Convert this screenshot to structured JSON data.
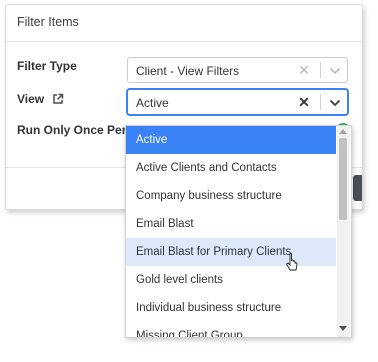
{
  "modal": {
    "title": "Filter Items"
  },
  "fields": {
    "filter_type_label": "Filter Type",
    "view_label": "View",
    "run_once_label": "Run Only Once Per Client"
  },
  "filter_type_select": {
    "value": "Client - View Filters"
  },
  "view_select": {
    "value": "Active"
  },
  "dropdown": {
    "options": [
      "Active",
      "Active Clients and Contacts",
      "Company business structure",
      "Email Blast",
      "Email Blast for Primary Clients",
      "Gold level clients",
      "Individual business structure",
      "Missing Client Group"
    ],
    "selected_index": 0,
    "hovered_index": 4
  },
  "colors": {
    "accent": "#3b82f6",
    "hover": "#dde8f8",
    "toggle_on": "#3bb36a"
  }
}
